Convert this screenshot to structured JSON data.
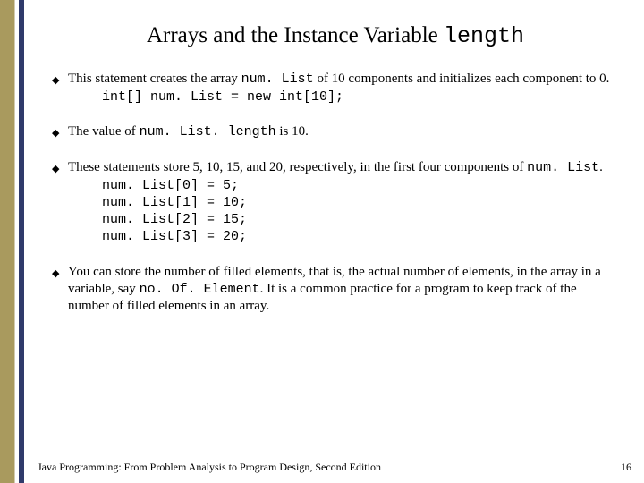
{
  "title": {
    "prefix": "Arrays and the Instance Variable ",
    "mono": "length"
  },
  "bullets": [
    {
      "runs": [
        {
          "t": "This statement creates the array "
        },
        {
          "t": "num. List",
          "mono": true
        },
        {
          "t": " of 10 components and initializes each component to 0."
        }
      ],
      "code": "int[] num. List = new int[10];"
    },
    {
      "runs": [
        {
          "t": "The value of "
        },
        {
          "t": "num. List. length",
          "mono": true
        },
        {
          "t": " is 10."
        }
      ]
    },
    {
      "runs": [
        {
          "t": "These statements store 5, 10, 15, and 20, respectively, in the first four components of "
        },
        {
          "t": "num. List",
          "mono": true
        },
        {
          "t": "."
        }
      ],
      "code": "num. List[0] = 5;\nnum. List[1] = 10;\nnum. List[2] = 15;\nnum. List[3] = 20;"
    },
    {
      "runs": [
        {
          "t": "You can store the number of filled elements, that is, the actual number of elements, in the array in a variable, say "
        },
        {
          "t": "no. Of. Element",
          "mono": true
        },
        {
          "t": ". It is a common practice for a program to keep track of the number of filled elements in an array."
        }
      ]
    }
  ],
  "footer": "Java Programming: From Problem Analysis to Program Design, Second Edition",
  "page": "16"
}
